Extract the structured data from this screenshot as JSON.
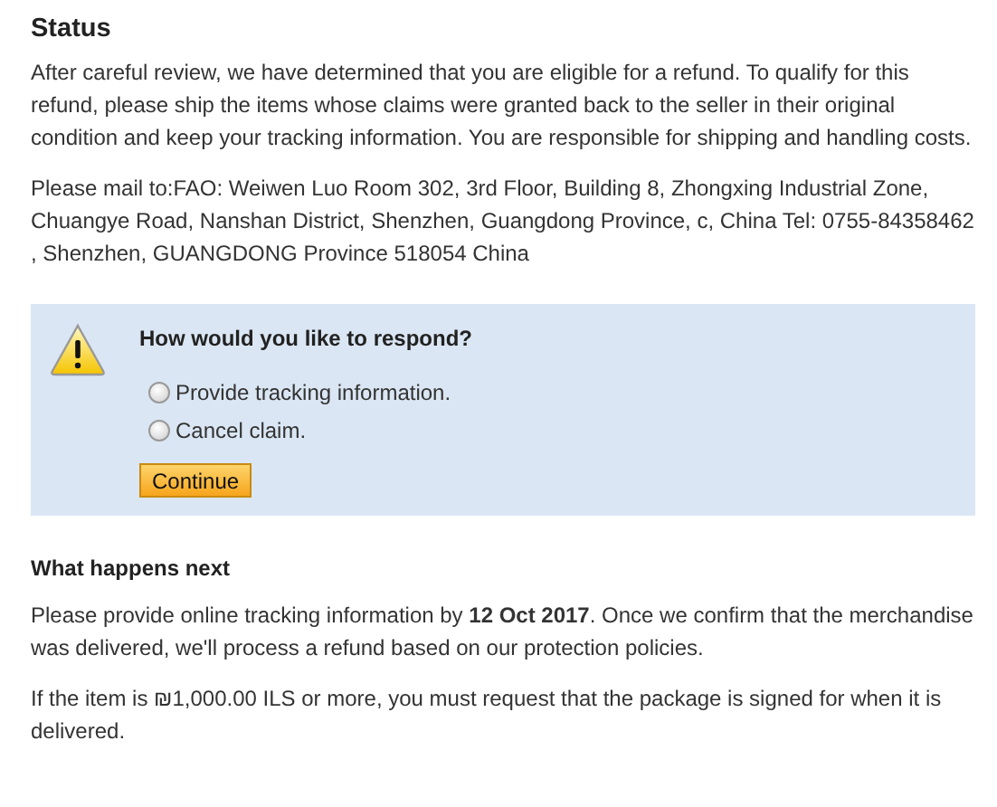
{
  "title": "Status",
  "paragraphs": [
    "After careful review, we have determined that you are eligible for a refund. To qualify for this refund, please ship the items whose claims were granted back to the seller in their original condition and keep your tracking information. You are responsible for shipping and handling costs.",
    "Please mail to:FAO: Weiwen Luo Room 302, 3rd Floor, Building 8, Zhongxing Industrial Zone, Chuangye Road, Nanshan District, Shenzhen, Guangdong Province, c, China Tel: 0755-84358462 , Shenzhen, GUANGDONG Province 518054 China"
  ],
  "respond": {
    "question": "How would you like to respond?",
    "options": [
      {
        "label": "Provide tracking information.",
        "selected": false
      },
      {
        "label": "Cancel claim.",
        "selected": false
      }
    ],
    "button": "Continue"
  },
  "next": {
    "heading": "What happens next",
    "paragraphs": [
      "Please provide online tracking information by **12 Oct 2017**. Once we confirm that the merchandise was delivered, we'll process a refund based on our protection policies.",
      "If the item is ₪1,000.00 ILS or more, you must request that the package is signed for when it is delivered."
    ]
  }
}
